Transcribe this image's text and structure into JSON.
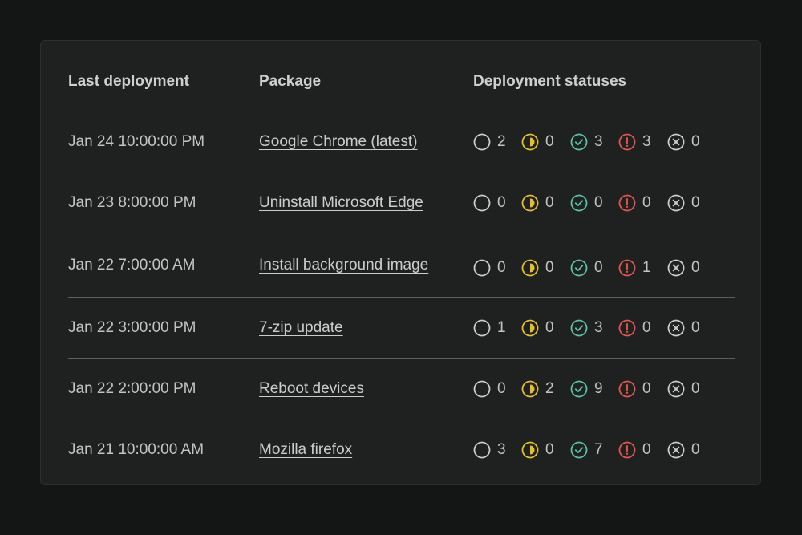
{
  "table": {
    "headers": {
      "last_deployment": "Last deployment",
      "package": "Package",
      "deployment_statuses": "Deployment statuses"
    },
    "status_icons": [
      {
        "name": "pending-circle-icon",
        "color": "#cfcfcf"
      },
      {
        "name": "half-circle-icon",
        "color": "#e2c12b"
      },
      {
        "name": "check-circle-icon",
        "color": "#5fc3a8"
      },
      {
        "name": "exclamation-circle-icon",
        "color": "#e0574f"
      },
      {
        "name": "x-circle-icon",
        "color": "#cfcfcf"
      }
    ],
    "rows": [
      {
        "date": "Jan 24 10:00:00 PM",
        "package": "Google Chrome (latest)",
        "statuses": [
          "2",
          "0",
          "3",
          "3",
          "0"
        ]
      },
      {
        "date": "Jan 23 8:00:00 PM",
        "package": "Uninstall Microsoft Edge",
        "statuses": [
          "0",
          "0",
          "0",
          "0",
          "0"
        ]
      },
      {
        "date": "Jan 22 7:00:00 AM",
        "package": "Install background image",
        "statuses": [
          "0",
          "0",
          "0",
          "1",
          "0"
        ]
      },
      {
        "date": "Jan 22 3:00:00 PM",
        "package": "7-zip update",
        "statuses": [
          "1",
          "0",
          "3",
          "0",
          "0"
        ]
      },
      {
        "date": "Jan 22 2:00:00 PM",
        "package": "Reboot devices",
        "statuses": [
          "0",
          "2",
          "9",
          "0",
          "0"
        ]
      },
      {
        "date": "Jan 21 10:00:00 AM",
        "package": "Mozilla firefox",
        "statuses": [
          "3",
          "0",
          "7",
          "0",
          "0"
        ]
      }
    ]
  }
}
